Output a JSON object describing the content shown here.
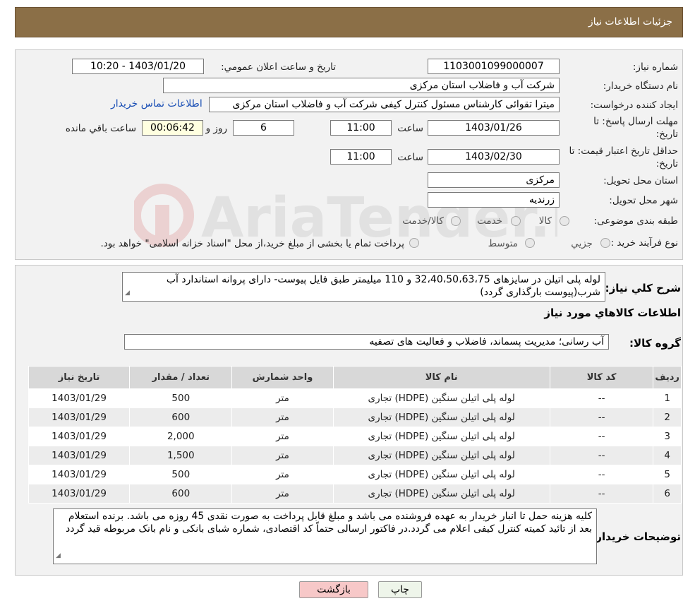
{
  "header": {
    "title": "جزئیات اطلاعات نیاز"
  },
  "form": {
    "need_number_label": "شماره نیاز:",
    "need_number": "1103001099000007",
    "announce_label": "تاریخ و ساعت اعلان عمومي:",
    "announce_value": "1403/01/20 - 10:20",
    "buyer_org_label": "نام دستگاه خريدار:",
    "buyer_org": "شرکت آب و فاضلاب استان مرکزی",
    "creator_label": "ايجاد کننده درخواست:",
    "creator": "میترا تقوائی کارشناس مسئول کنترل کیفی شرکت آب و فاضلاب استان مرکزی",
    "contact_link": "اطلاعات تماس خريدار",
    "reply_deadline_label_1": "مهلت ارسال پاسخ: تا",
    "reply_deadline_label_2": "تاریخ:",
    "reply_date": "1403/01/26",
    "time_label": "ساعت",
    "reply_time": "11:00",
    "days_value": "6",
    "days_label": "روز و",
    "remaining_value": "00:06:42",
    "remaining_label": "ساعت باقي مانده",
    "validity_label_1": "حداقل تاريخ اعتبار قيمت: تا",
    "validity_label_2": "تاريخ:",
    "validity_date": "1403/02/30",
    "validity_time": "11:00",
    "province_label": "استان محل تحويل:",
    "province": "مرکزی",
    "city_label": "شهر محل تحويل:",
    "city": "زرندیه",
    "category_label": "طبقه بندی موضوعی:",
    "category_options": [
      "کالا",
      "خدمت",
      "کالا/خدمت"
    ],
    "process_label": "نوع فرآيند خريد :",
    "process_options": [
      "جزيي",
      "متوسط"
    ],
    "process_note": "پرداخت تمام یا بخشی از مبلغ خرید،از محل \"اسناد خزانه اسلامی\" خواهد بود."
  },
  "watermark": {
    "text": "AriaTender.neT"
  },
  "details": {
    "summary_label": "شرح کلي نياز:",
    "summary": "لوله پلی اتیلن در سایزهای 32،40،50،63،75 و 110 میلیمتر طبق فایل پیوست- دارای پروانه استاندارد آب شرب(پیوست بارگذاری گردد)",
    "items_title": "اطلاعات کالاهاي مورد نياز",
    "group_label": "گروه کالا:",
    "group": "آب رسانی؛ مدیریت پسماند، فاضلاب و فعالیت های تصفیه"
  },
  "table": {
    "headers": [
      "رديف",
      "کد کالا",
      "نام کالا",
      "واحد شمارش",
      "تعداد / مقدار",
      "تاريخ نياز"
    ],
    "rows": [
      [
        "1",
        "--",
        "لوله پلی اتیلن سنگین (HDPE) تجاری",
        "متر",
        "500",
        "1403/01/29"
      ],
      [
        "2",
        "--",
        "لوله پلی اتیلن سنگین (HDPE) تجاری",
        "متر",
        "600",
        "1403/01/29"
      ],
      [
        "3",
        "--",
        "لوله پلی اتیلن سنگین (HDPE) تجاری",
        "متر",
        "2,000",
        "1403/01/29"
      ],
      [
        "4",
        "--",
        "لوله پلی اتیلن سنگین (HDPE) تجاری",
        "متر",
        "1,500",
        "1403/01/29"
      ],
      [
        "5",
        "--",
        "لوله پلی اتیلن سنگین (HDPE) تجاری",
        "متر",
        "500",
        "1403/01/29"
      ],
      [
        "6",
        "--",
        "لوله پلی اتیلن سنگین (HDPE) تجاری",
        "متر",
        "600",
        "1403/01/29"
      ]
    ]
  },
  "buyer_notes": {
    "label": "توضيحات خريدار:",
    "text": "کلیه هزینه حمل تا انبار خریدار به عهده فروشنده می باشد و مبلغ قابل پرداخت به صورت نقدی 45 روزه می باشد. برنده استعلام بعد از تائید کمیته کنترل کیفی اعلام می گردد.در فاکتور ارسالی حتماً کد اقتصادی، شماره شبای بانکی و نام بانک مربوطه قید گردد"
  },
  "buttons": {
    "print": "چاپ",
    "back": "بازگشت"
  }
}
